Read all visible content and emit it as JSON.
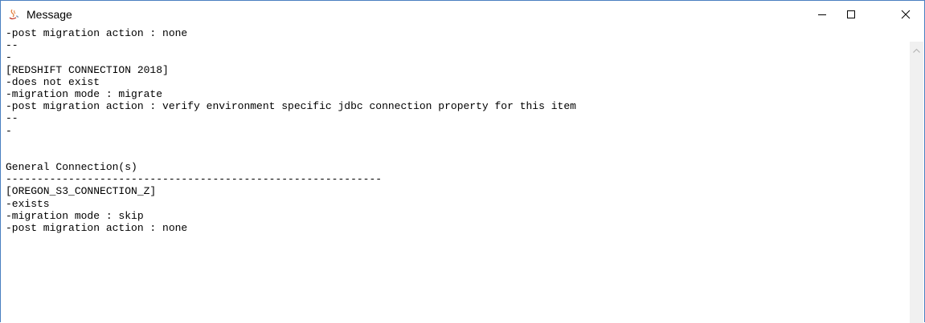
{
  "window": {
    "title": "Message",
    "app_icon": "java-cup-icon",
    "controls": {
      "minimize": "minimize-icon",
      "maximize": "maximize-icon",
      "close": "close-icon"
    }
  },
  "content": {
    "lines": [
      "-post migration action : none",
      "--",
      "-",
      "[REDSHIFT CONNECTION 2018]",
      "-does not exist",
      "-migration mode : migrate",
      "-post migration action : verify environment specific jdbc connection property for this item",
      "--",
      "-",
      "",
      "",
      "General Connection(s)",
      "------------------------------------------------------------",
      "[OREGON_S3_CONNECTION_Z]",
      "-exists",
      "-migration mode : skip",
      "-post migration action : none"
    ]
  },
  "scrollbar": {
    "up_arrow": "chevron-up-icon"
  }
}
